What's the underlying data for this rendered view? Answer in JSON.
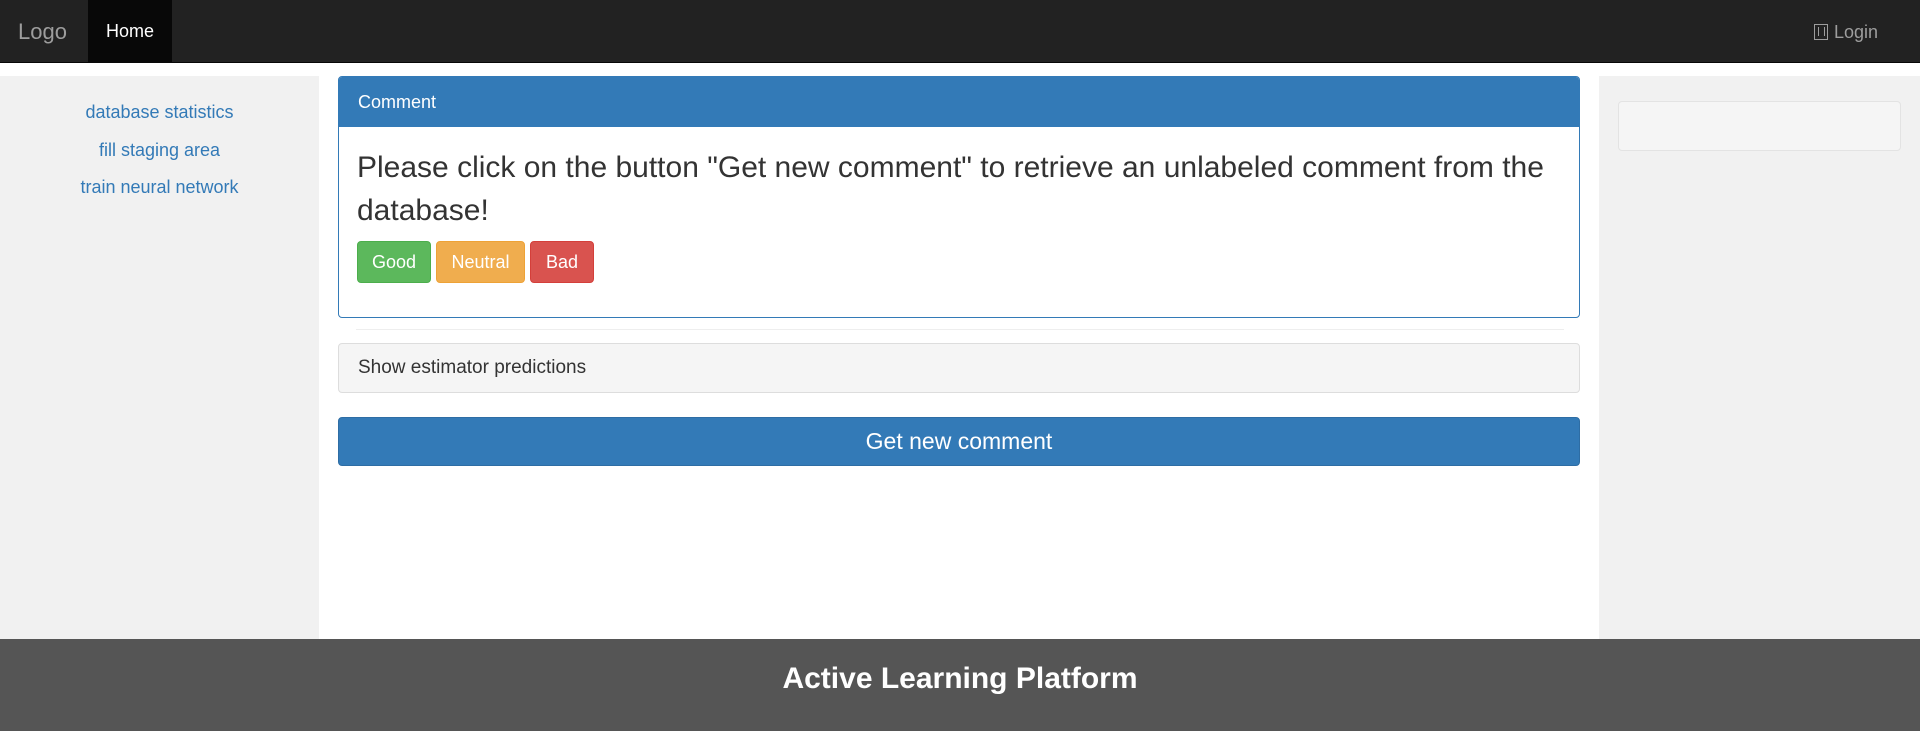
{
  "navbar": {
    "brand": "Logo",
    "home_label": "Home",
    "login_label": "Login"
  },
  "sidebar": {
    "items": [
      {
        "label": "database statistics"
      },
      {
        "label": "fill staging area"
      },
      {
        "label": "train neural network"
      }
    ]
  },
  "panel": {
    "heading": "Comment",
    "prompt": "Please click on the button \"Get new comment\" to retrieve an unlabeled comment from the database!",
    "buttons": {
      "good": "Good",
      "neutral": "Neutral",
      "bad": "Bad"
    }
  },
  "predictions": {
    "label": "Show estimator predictions"
  },
  "actions": {
    "get_new_comment": "Get new comment"
  },
  "footer": {
    "title": "Active Learning Platform"
  },
  "colors": {
    "primary": "#337ab7",
    "success": "#5cb85c",
    "warning": "#f0ad4e",
    "danger": "#d9534f",
    "navbar": "#222222",
    "footer": "#555555"
  },
  "icons": {
    "login": "log-in-icon"
  }
}
